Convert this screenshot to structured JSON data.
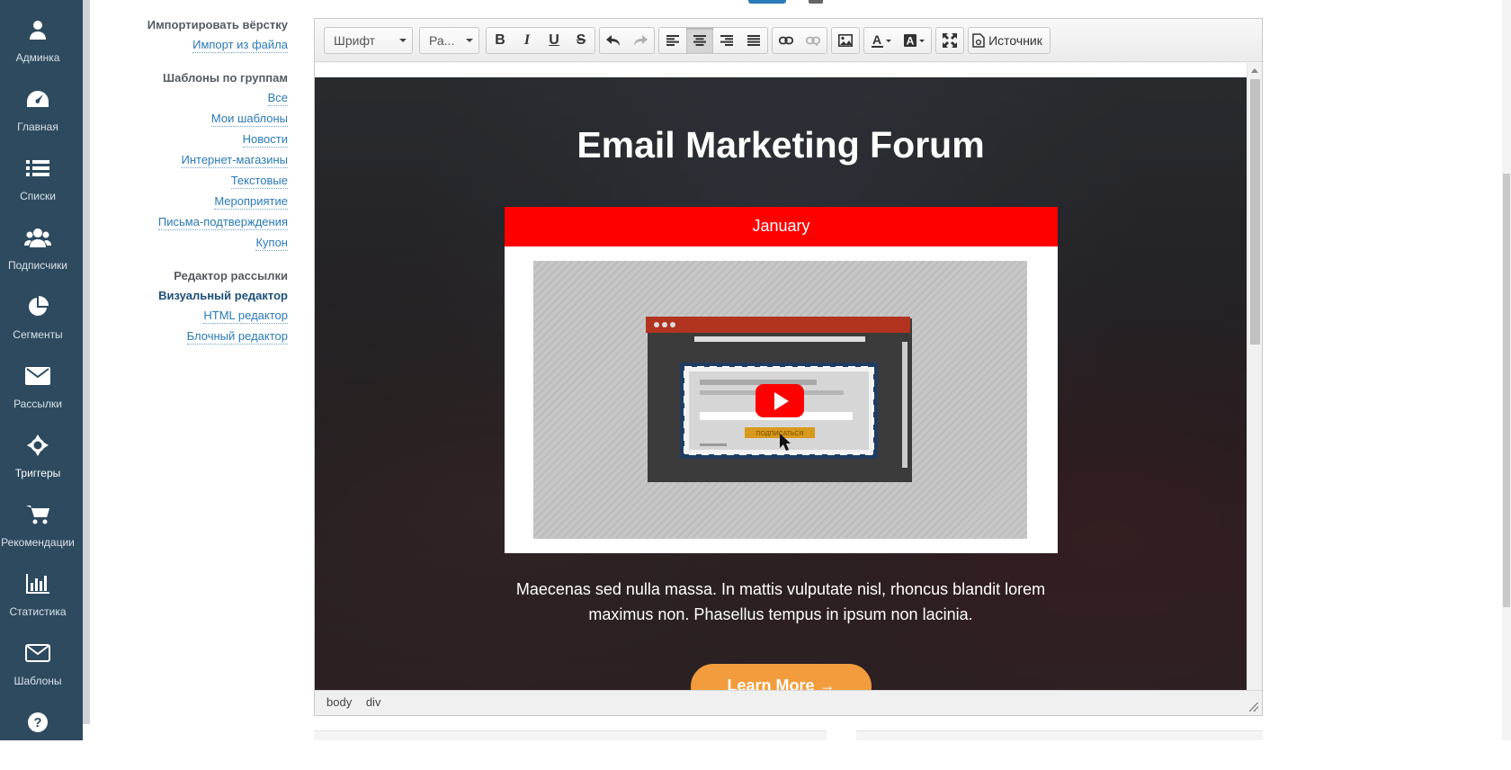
{
  "sidebar": {
    "items": [
      {
        "label": "Админка",
        "icon": "admin-user-icon"
      },
      {
        "label": "Главная",
        "icon": "dashboard-icon"
      },
      {
        "label": "Списки",
        "icon": "list-icon"
      },
      {
        "label": "Подписчики",
        "icon": "users-icon"
      },
      {
        "label": "Сегменты",
        "icon": "pie-chart-icon"
      },
      {
        "label": "Рассылки",
        "icon": "envelope-icon"
      },
      {
        "label": "Триггеры",
        "icon": "trigger-icon"
      },
      {
        "label": "Рекомендации",
        "icon": "cart-icon"
      },
      {
        "label": "Статистика",
        "icon": "bar-chart-icon"
      },
      {
        "label": "Шаблоны",
        "icon": "envelope-outline-icon"
      },
      {
        "label": "",
        "icon": "help-icon"
      }
    ],
    "active": "Триггеры"
  },
  "settings": {
    "import_heading": "Импортировать вёрстку",
    "import_link": "Импорт из файла",
    "groups_heading": "Шаблоны по группам",
    "groups": [
      "Все",
      "Мои шаблоны",
      "Новости",
      "Интернет-магазины",
      "Текстовые",
      "Мероприятие",
      "Письма-подтверждения",
      "Купон"
    ],
    "editor_heading": "Редактор рассылки",
    "editors": [
      "Визуальный редактор",
      "HTML редактор",
      "Блочный редактор"
    ]
  },
  "toolbar": {
    "font_label": "Шрифт",
    "size_label": "Ра...",
    "source_label": "Источник"
  },
  "email": {
    "title": "Email Marketing Forum",
    "card_header": "January",
    "body_line1": "Maecenas sed nulla massa. In mattis vulputate nisl, rhoncus blandit lorem",
    "body_line2": "maximus non. Phasellus tempus in ipsum non lacinia.",
    "cta": "Learn More →",
    "video_subscribe": "ПОДПИСАТЬСЯ"
  },
  "statusbar": {
    "path": [
      "body",
      "div"
    ]
  },
  "colors": {
    "sidebar": "#2e4a5f",
    "link": "#2a7ab8",
    "card_header": "#ff0000",
    "cta": "#f39c3d"
  }
}
